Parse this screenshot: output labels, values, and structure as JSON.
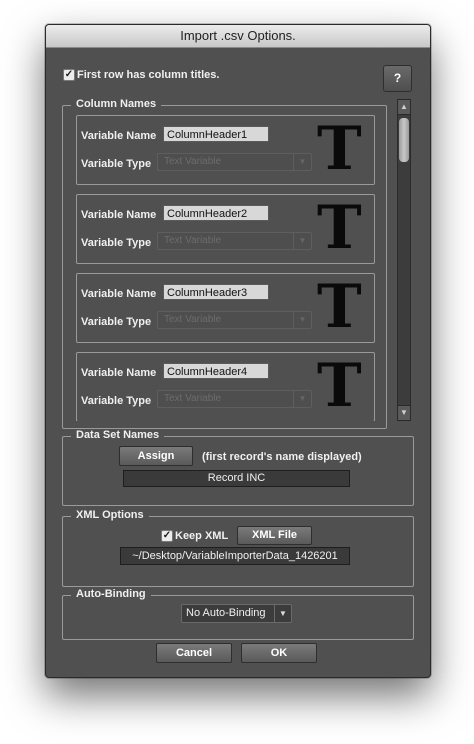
{
  "window": {
    "title": "Import .csv Options."
  },
  "first_row": {
    "label": "First row has column titles.",
    "checked": true
  },
  "help_button": {
    "label": "?"
  },
  "column_names": {
    "title": "Column Names",
    "name_label": "Variable Name",
    "type_label": "Variable Type",
    "type_glyph": "T",
    "columns": [
      {
        "name": "ColumnHeader1",
        "type": "Text Variable"
      },
      {
        "name": "ColumnHeader2",
        "type": "Text Variable"
      },
      {
        "name": "ColumnHeader3",
        "type": "Text Variable"
      },
      {
        "name": "ColumnHeader4",
        "type": "Text Variable"
      }
    ]
  },
  "data_set_names": {
    "title": "Data Set Names",
    "assign_label": "Assign",
    "note": "(first record's name displayed)",
    "record_name": "Record INC"
  },
  "xml_options": {
    "title": "XML Options",
    "keep_xml_label": "Keep XML",
    "keep_xml_checked": true,
    "xml_file_label": "XML File",
    "path": "~/Desktop/VariableImporterData_1426201"
  },
  "auto_binding": {
    "title": "Auto-Binding",
    "selected": "No Auto-Binding"
  },
  "footer": {
    "cancel_label": "Cancel",
    "ok_label": "OK"
  }
}
